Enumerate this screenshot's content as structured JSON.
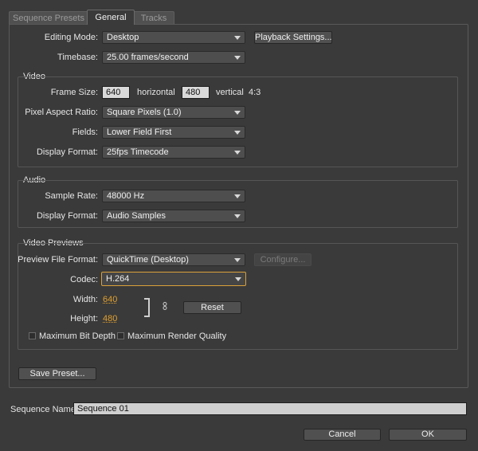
{
  "tabs": [
    "Sequence Presets",
    "General",
    "Tracks"
  ],
  "general": {
    "editing_mode_label": "Editing Mode:",
    "editing_mode_value": "Desktop",
    "playback_settings_button": "Playback Settings...",
    "timebase_label": "Timebase:",
    "timebase_value": "25.00 frames/second"
  },
  "video": {
    "title": "Video",
    "frame_size_label": "Frame Size:",
    "frame_width": "640",
    "horizontal_label": "horizontal",
    "frame_height": "480",
    "vertical_label": "vertical",
    "aspect": "4:3",
    "par_label": "Pixel Aspect Ratio:",
    "par_value": "Square Pixels (1.0)",
    "fields_label": "Fields:",
    "fields_value": "Lower Field First",
    "display_format_label": "Display Format:",
    "display_format_value": "25fps Timecode"
  },
  "audio": {
    "title": "Audio",
    "sample_rate_label": "Sample Rate:",
    "sample_rate_value": "48000 Hz",
    "display_format_label": "Display Format:",
    "display_format_value": "Audio Samples"
  },
  "previews": {
    "title": "Video Previews",
    "file_format_label": "Preview File Format:",
    "file_format_value": "QuickTime (Desktop)",
    "configure_button": "Configure...",
    "codec_label": "Codec:",
    "codec_value": "H.264",
    "width_label": "Width:",
    "width_value": "640",
    "height_label": "Height:",
    "height_value": "480",
    "reset_button": "Reset",
    "max_bit_depth_label": "Maximum Bit Depth",
    "max_render_quality_label": "Maximum Render Quality"
  },
  "save_preset_button": "Save Preset...",
  "sequence_name_label": "Sequence Name:",
  "sequence_name_value": "Sequence 01",
  "cancel_button": "Cancel",
  "ok_button": "OK",
  "colors": {
    "accent": "#e0a030",
    "background": "#3a3a3a"
  }
}
